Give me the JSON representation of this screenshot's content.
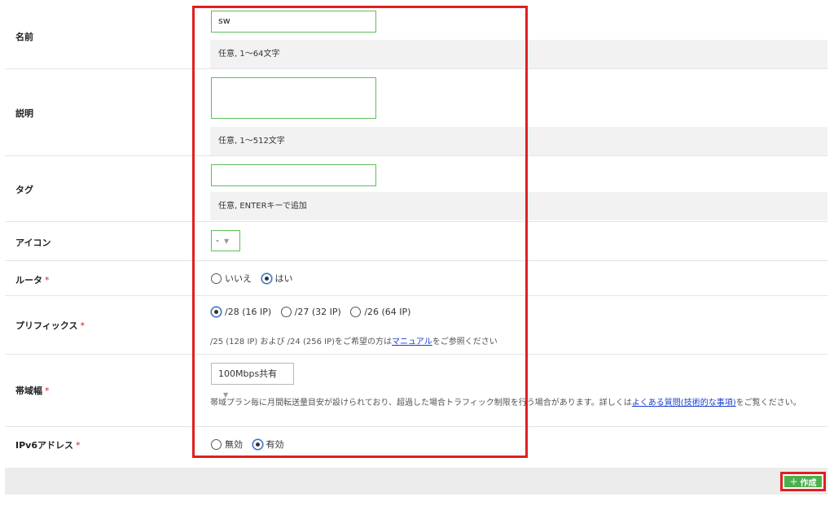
{
  "fields": {
    "name": {
      "label": "名前",
      "value": "sw",
      "hint": "任意, 1〜64文字"
    },
    "description": {
      "label": "説明",
      "value": "",
      "hint": "任意, 1〜512文字"
    },
    "tags": {
      "label": "タグ",
      "value": "",
      "hint": "任意, ENTERキーで追加"
    },
    "icon": {
      "label": "アイコン",
      "selected": "-"
    },
    "router": {
      "label": "ルータ",
      "required_mark": "*",
      "options": [
        "いいえ",
        "はい"
      ],
      "selected": "はい"
    },
    "prefix": {
      "label": "プリフィックス",
      "required_mark": "*",
      "options": [
        "/28 (16 IP)",
        "/27 (32 IP)",
        "/26 (64 IP)"
      ],
      "selected": "/28 (16 IP)",
      "note_before": "/25 (128 IP) および /24 (256 IP)をご希望の方は",
      "note_link": "マニュアル",
      "note_after": "をご参照ください"
    },
    "bandwidth": {
      "label": "帯域幅",
      "required_mark": "*",
      "selected": "100Mbps共有",
      "note_before": "帯域プラン毎に月間転送量目安が設けられており、超過した場合トラフィック制限を行う場合があります。詳しくは",
      "note_link": "よくある質問(技術的な事項)",
      "note_after": "をご覧ください。"
    },
    "ipv6": {
      "label": "IPv6アドレス",
      "required_mark": "*",
      "options": [
        "無効",
        "有効"
      ],
      "selected": "有効"
    }
  },
  "footer": {
    "create_label": "作成"
  },
  "colors": {
    "accent_green": "#4cb04c",
    "highlight_red": "#e02020",
    "link_blue": "#1a3fd0"
  }
}
